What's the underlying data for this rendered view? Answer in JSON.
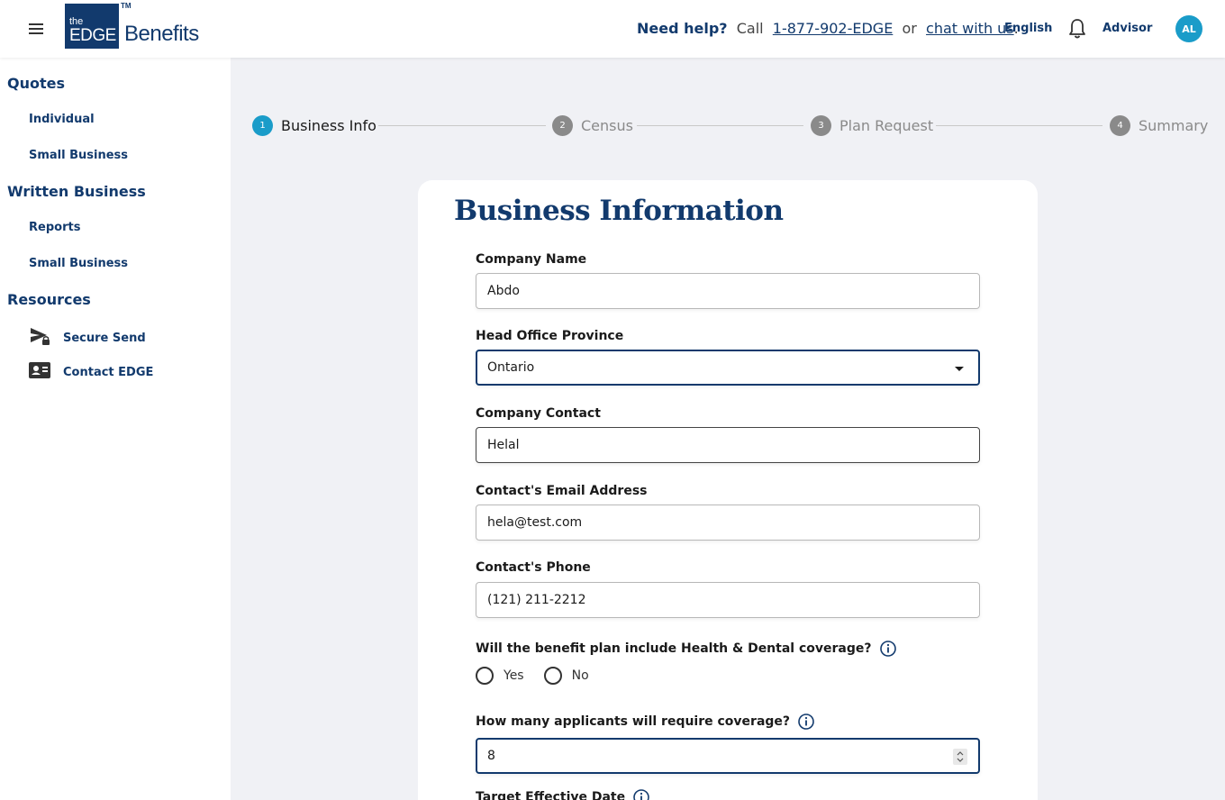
{
  "header": {
    "logo": {
      "the": "the",
      "edge": "EDGE",
      "tm": "TM",
      "benefits": "Benefits"
    },
    "help_prefix": "Need help?",
    "call": "Call",
    "phone": "1-877-902-EDGE",
    "or": "or",
    "chat": "chat with us",
    "period": ".",
    "language": "English",
    "role": "Advisor",
    "avatar_initials": "AL"
  },
  "sidebar": {
    "quotes": {
      "title": "Quotes",
      "items": [
        "Individual",
        "Small Business"
      ]
    },
    "written": {
      "title": "Written Business",
      "items": [
        "Reports",
        "Small Business"
      ]
    },
    "resources": {
      "title": "Resources",
      "items": [
        {
          "label": "Secure Send",
          "icon": "send-lock-icon"
        },
        {
          "label": "Contact EDGE",
          "icon": "contact-card-icon"
        }
      ]
    }
  },
  "stepper": {
    "steps": [
      {
        "num": "1",
        "label": "Business Info",
        "active": true
      },
      {
        "num": "2",
        "label": "Census",
        "active": false
      },
      {
        "num": "3",
        "label": "Plan Request",
        "active": false
      },
      {
        "num": "4",
        "label": "Summary",
        "active": false
      }
    ]
  },
  "form": {
    "title": "Business Information",
    "company_name": {
      "label": "Company Name",
      "value": "Abdo"
    },
    "province": {
      "label": "Head Office Province",
      "value": "Ontario"
    },
    "contact": {
      "label": "Company Contact",
      "value": "Helal"
    },
    "email": {
      "label": "Contact's Email Address",
      "value": "hela@test.com"
    },
    "phone": {
      "label": "Contact's Phone",
      "value": "(121) 211-2212"
    },
    "health_dental": {
      "question": "Will the benefit plan include Health & Dental coverage?",
      "options": [
        "Yes",
        "No"
      ]
    },
    "applicants": {
      "question": "How many applicants will require coverage?",
      "value": "8"
    },
    "effective_date": {
      "label": "Target Effective Date"
    }
  },
  "colors": {
    "brand": "#123a6d",
    "accent": "#1a9cc9",
    "inactive": "#8a8a8a"
  }
}
